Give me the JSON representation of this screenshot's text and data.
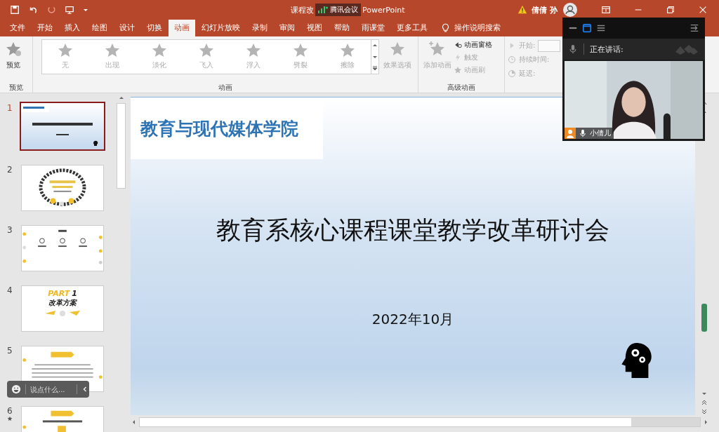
{
  "title_bar": {
    "title_start": "课程改",
    "title_end": "PowerPoint",
    "overlay_label": "腾讯会议",
    "user": "倩倩 孙"
  },
  "tabs": [
    {
      "label": "文件",
      "selected": false
    },
    {
      "label": "开始",
      "selected": false
    },
    {
      "label": "插入",
      "selected": false
    },
    {
      "label": "绘图",
      "selected": false
    },
    {
      "label": "设计",
      "selected": false
    },
    {
      "label": "切换",
      "selected": false
    },
    {
      "label": "动画",
      "selected": true
    },
    {
      "label": "幻灯片放映",
      "selected": false
    },
    {
      "label": "录制",
      "selected": false
    },
    {
      "label": "审阅",
      "selected": false
    },
    {
      "label": "视图",
      "selected": false
    },
    {
      "label": "帮助",
      "selected": false
    },
    {
      "label": "雨课堂",
      "selected": false
    },
    {
      "label": "更多工具",
      "selected": false
    }
  ],
  "tell_me": "操作说明搜索",
  "ribbon": {
    "preview": {
      "button": "预览",
      "group": "预览"
    },
    "animations": {
      "items": [
        "无",
        "出现",
        "淡化",
        "飞入",
        "浮入",
        "劈裂",
        "擦除"
      ],
      "effect_options": "效果选项",
      "group": "动画"
    },
    "advanced": {
      "add": "添加动画",
      "pane": "动画窗格",
      "trigger": "触发",
      "painter": "动画刷",
      "group": "高级动画"
    },
    "timing": {
      "start": "开始:",
      "duration": "持续时间:",
      "delay": "延迟:"
    }
  },
  "thumbnails": [
    {
      "number": "1",
      "selected": true,
      "animated": false,
      "kind": "title"
    },
    {
      "number": "2",
      "selected": false,
      "animated": false,
      "kind": "wreath"
    },
    {
      "number": "3",
      "selected": false,
      "animated": false,
      "kind": "toc"
    },
    {
      "number": "4",
      "selected": false,
      "animated": false,
      "kind": "part",
      "texts": [
        "PART",
        "1",
        "改革方案"
      ]
    },
    {
      "number": "5",
      "selected": false,
      "animated": false,
      "kind": "text"
    },
    {
      "number": "6",
      "selected": false,
      "animated": true,
      "kind": "banner"
    }
  ],
  "slide": {
    "header": "教育与现代媒体学院",
    "title": "教育系核心课程课堂教学改革研讨会",
    "date": "2022年10月"
  },
  "meeting": {
    "speaking_label": "正在讲话:",
    "participant": "小倩儿"
  },
  "chat": {
    "placeholder": "说点什么..."
  }
}
